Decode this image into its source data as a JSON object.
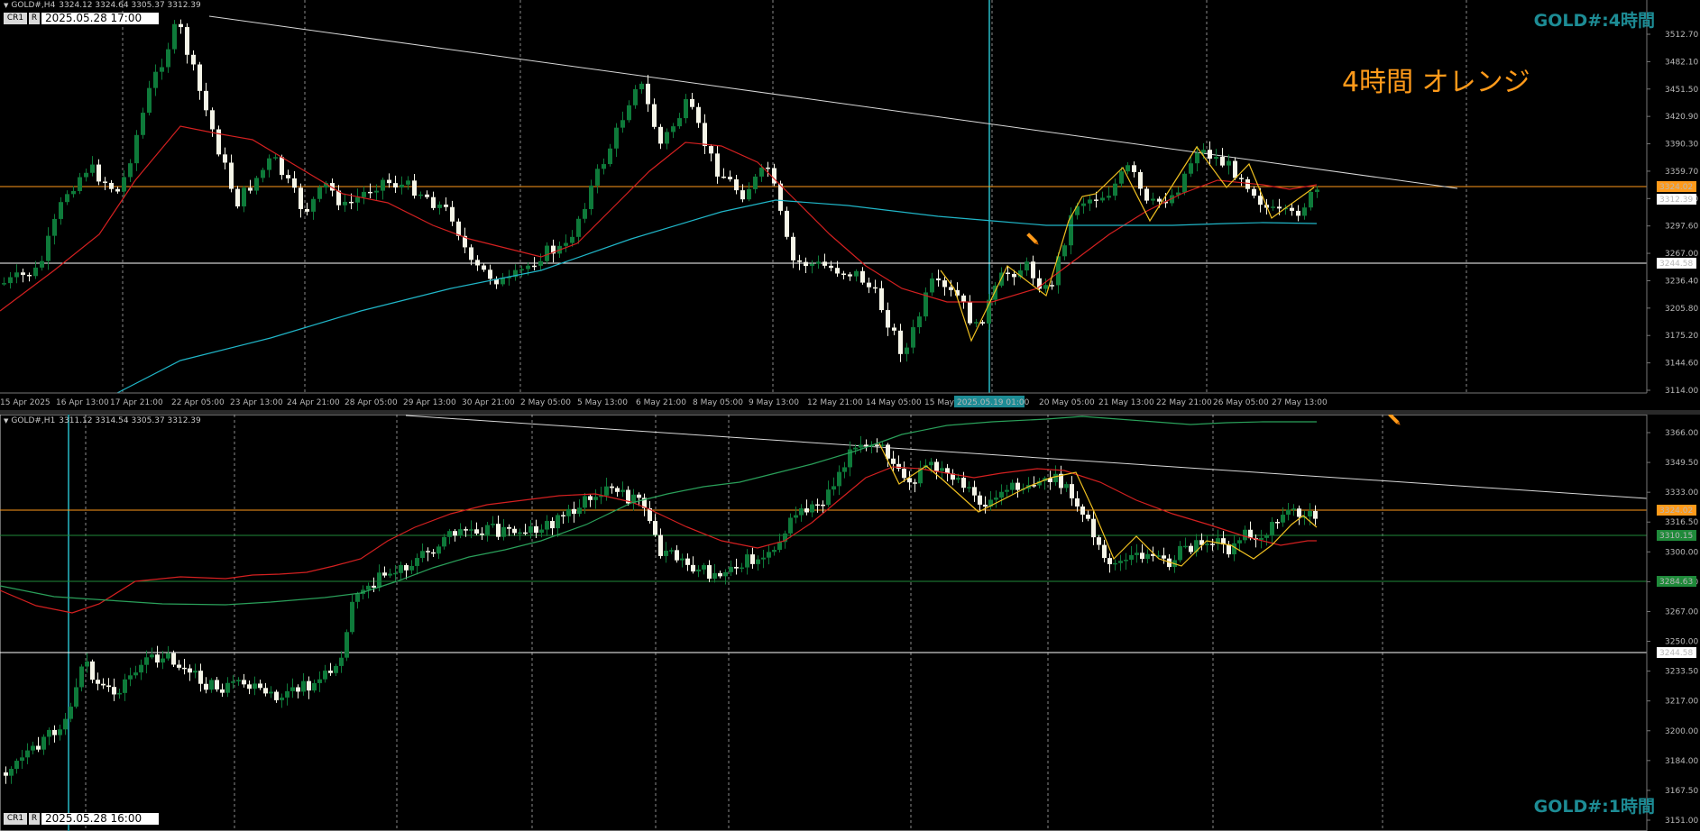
{
  "top": {
    "header": {
      "symbol": "GOLD#,H4",
      "ohlc": "3324.12 3324.64 3305.37 3312.39"
    },
    "tag_cr": "CR1",
    "tag_r": "R",
    "crosshair_time": "2025.05.28 17:00",
    "title": "GOLD#:4時間",
    "note": "4時間  オレンジ",
    "y_axis": [
      "3512.70",
      "3482.10",
      "3451.50",
      "3420.90",
      "3390.30",
      "3359.70",
      "3329.10",
      "3297.60",
      "3267.00",
      "3236.40",
      "3205.80",
      "3175.20",
      "3144.60",
      "3114.00"
    ],
    "price_tags": {
      "orange": "3324.02",
      "current": "3312.39",
      "white": "3244.58"
    },
    "x_axis": [
      "15 Apr 2025",
      "16 Apr 13:00",
      "17 Apr 21:00",
      "22 Apr 05:00",
      "23 Apr 13:00",
      "24 Apr 21:00",
      "28 Apr 05:00",
      "29 Apr 13:00",
      "30 Apr 21:00",
      "2 May 05:00",
      "5 May 13:00",
      "6 May 21:00",
      "8 May 05:00",
      "9 May 13:00",
      "12 May 21:00",
      "14 May 05:00",
      "15 May",
      "20 May 05:00",
      "21 May 13:00",
      "22 May 21:00",
      "26 May 05:00",
      "27 May 13:00"
    ],
    "x_highlight": "2025.05.19 01:00"
  },
  "bottom": {
    "header": {
      "symbol": "GOLD#,H1",
      "ohlc": "3311.12 3314.54 3305.37 3312.39"
    },
    "tag_cr": "CR1",
    "tag_r": "R",
    "crosshair_time": "2025.05.28 16:00",
    "title": "GOLD#:1時間",
    "y_axis": [
      "3366.00",
      "3349.50",
      "3333.00",
      "3316.50",
      "3300.00",
      "3283.50",
      "3267.00",
      "3250.00",
      "3233.50",
      "3217.00",
      "3200.00",
      "3184.00",
      "3167.50",
      "3151.00"
    ],
    "price_tags": {
      "orange": "3324.02",
      "green_current": "3310.15",
      "green_low": "3284.63",
      "white": "3244.58"
    }
  },
  "colors": {
    "background": "#000000",
    "bull": "#0e7a3a",
    "bear": "#f5f5e8",
    "ma_short": "#d42020",
    "ma_long_top": "#20b6c8",
    "ma_long_bot": "#2aa05a",
    "zigzag": "#f0c020",
    "orange_line": "#ff9a1a",
    "green_line": "#1f8a3a",
    "crosshair": "#1d8c95",
    "title": "#1d8c95"
  },
  "icons": {
    "pencil": "pencil-icon"
  }
}
